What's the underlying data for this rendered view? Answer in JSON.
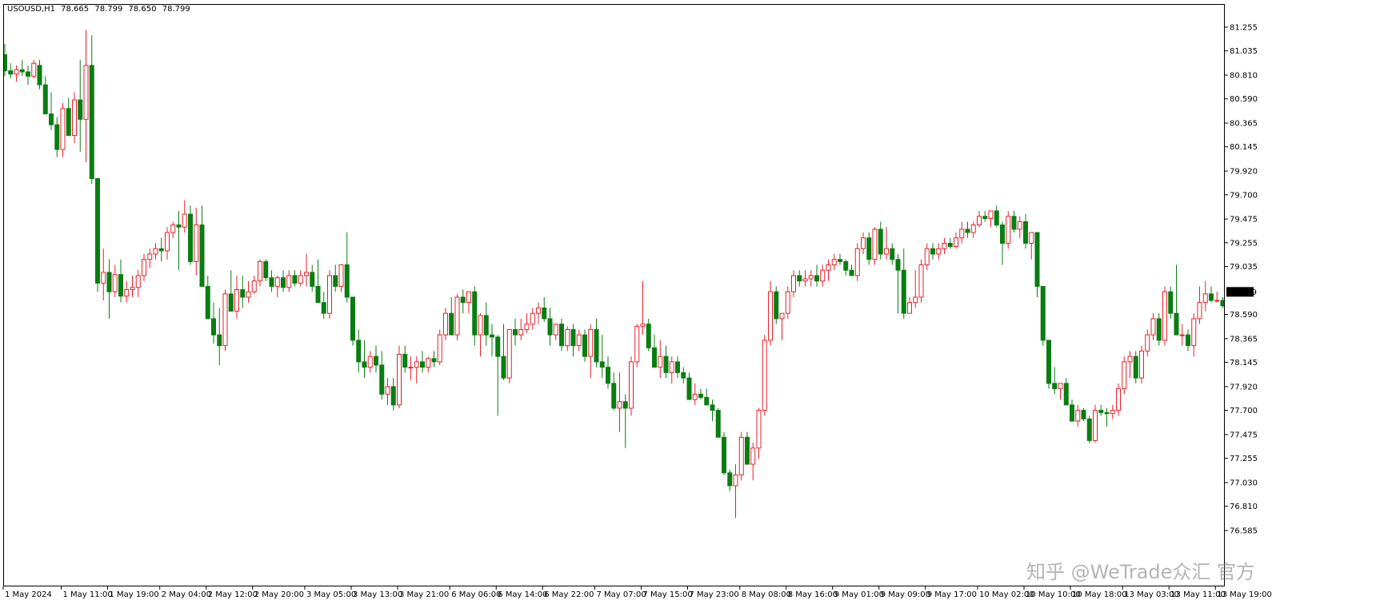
{
  "header": {
    "symbol": "USOUSD,H1",
    "open": "78.665",
    "high": "78.799",
    "low": "78.650",
    "close": "78.799"
  },
  "watermark": "知乎 @WeTrade众汇 官方",
  "colors": {
    "bull": "#e8202a",
    "bear": "#0a7d12",
    "axis": "#000000",
    "current_bg": "#000000",
    "current_fg": "#ffffff"
  },
  "chart_data": {
    "type": "candlestick",
    "title": "USOUSD,H1",
    "current_price": "78.799",
    "ylim": [
      76.6,
      81.5
    ],
    "y_ticks": [
      "81.255",
      "81.035",
      "80.810",
      "80.590",
      "80.365",
      "80.145",
      "79.920",
      "79.700",
      "79.475",
      "79.255",
      "79.035",
      "78.799",
      "78.590",
      "78.365",
      "78.145",
      "77.920",
      "77.700",
      "77.475",
      "77.255",
      "77.030",
      "76.810",
      "76.585"
    ],
    "y_tick_values": [
      81.255,
      81.035,
      80.81,
      80.59,
      80.365,
      80.145,
      79.92,
      79.7,
      79.475,
      79.255,
      79.035,
      78.799,
      78.59,
      78.365,
      78.145,
      77.92,
      77.7,
      77.475,
      77.255,
      77.03,
      76.81,
      76.585
    ],
    "x_ticks": [
      {
        "label": "1 May 2024",
        "index": 0
      },
      {
        "label": "1 May 11:00",
        "index": 10
      },
      {
        "label": "1 May 19:00",
        "index": 18
      },
      {
        "label": "2 May 04:00",
        "index": 27
      },
      {
        "label": "2 May 12:00",
        "index": 35
      },
      {
        "label": "2 May 20:00",
        "index": 43
      },
      {
        "label": "3 May 05:00",
        "index": 52
      },
      {
        "label": "3 May 13:00",
        "index": 60
      },
      {
        "label": "3 May 21:00",
        "index": 68
      },
      {
        "label": "6 May 06:00",
        "index": 77
      },
      {
        "label": "6 May 14:00",
        "index": 85
      },
      {
        "label": "6 May 22:00",
        "index": 93
      },
      {
        "label": "7 May 07:00",
        "index": 102
      },
      {
        "label": "7 May 15:00",
        "index": 110
      },
      {
        "label": "7 May 23:00",
        "index": 118
      },
      {
        "label": "8 May 08:00",
        "index": 127
      },
      {
        "label": "8 May 16:00",
        "index": 135
      },
      {
        "label": "9 May 01:00",
        "index": 143
      },
      {
        "label": "9 May 09:00",
        "index": 151
      },
      {
        "label": "9 May 17:00",
        "index": 159
      },
      {
        "label": "10 May 02:00",
        "index": 168
      },
      {
        "label": "10 May 10:00",
        "index": 176
      },
      {
        "label": "10 May 18:00",
        "index": 184
      },
      {
        "label": "13 May 03:00",
        "index": 193
      },
      {
        "label": "13 May 11:00",
        "index": 201
      },
      {
        "label": "13 May 19:00",
        "index": 209
      }
    ],
    "ohlc": [
      [
        81.0,
        81.1,
        80.8,
        80.85
      ],
      [
        80.85,
        80.92,
        80.78,
        80.82
      ],
      [
        80.82,
        80.9,
        80.75,
        80.86
      ],
      [
        80.86,
        80.95,
        80.8,
        80.84
      ],
      [
        80.84,
        80.9,
        80.72,
        80.8
      ],
      [
        80.8,
        80.95,
        80.78,
        80.92
      ],
      [
        80.9,
        80.95,
        80.68,
        80.72
      ],
      [
        80.72,
        80.8,
        80.45,
        80.45
      ],
      [
        80.45,
        80.65,
        80.3,
        80.35
      ],
      [
        80.35,
        80.42,
        80.05,
        80.12
      ],
      [
        80.12,
        80.55,
        80.05,
        80.5
      ],
      [
        80.5,
        80.6,
        80.25,
        80.25
      ],
      [
        80.25,
        80.65,
        80.18,
        80.58
      ],
      [
        80.58,
        80.95,
        80.1,
        80.4
      ],
      [
        80.4,
        81.23,
        80.0,
        80.9
      ],
      [
        80.9,
        81.18,
        79.8,
        79.85
      ],
      [
        79.85,
        79.85,
        78.8,
        78.88
      ],
      [
        78.88,
        79.2,
        78.72,
        78.98
      ],
      [
        78.98,
        79.1,
        78.55,
        78.8
      ],
      [
        78.8,
        79.05,
        78.75,
        78.96
      ],
      [
        78.96,
        79.1,
        78.7,
        78.76
      ],
      [
        78.76,
        78.9,
        78.7,
        78.82
      ],
      [
        78.82,
        78.95,
        78.75,
        78.84
      ],
      [
        78.84,
        79.0,
        78.75,
        78.95
      ],
      [
        78.95,
        79.15,
        78.9,
        79.1
      ],
      [
        79.1,
        79.2,
        79.02,
        79.15
      ],
      [
        79.15,
        79.25,
        79.1,
        79.2
      ],
      [
        79.2,
        79.3,
        79.08,
        79.18
      ],
      [
        79.18,
        79.4,
        79.1,
        79.35
      ],
      [
        79.35,
        79.45,
        79.3,
        79.42
      ],
      [
        79.42,
        79.55,
        79.0,
        79.4
      ],
      [
        79.4,
        79.65,
        79.35,
        79.52
      ],
      [
        79.52,
        79.6,
        79.05,
        79.08
      ],
      [
        79.08,
        79.58,
        78.95,
        79.42
      ],
      [
        79.42,
        79.6,
        78.85,
        78.85
      ],
      [
        78.85,
        78.95,
        78.55,
        78.55
      ],
      [
        78.55,
        78.7,
        78.32,
        78.4
      ],
      [
        78.4,
        78.65,
        78.12,
        78.3
      ],
      [
        78.3,
        78.82,
        78.25,
        78.78
      ],
      [
        78.78,
        79.0,
        78.62,
        78.62
      ],
      [
        78.62,
        78.95,
        78.55,
        78.82
      ],
      [
        78.82,
        78.95,
        78.65,
        78.75
      ],
      [
        78.75,
        78.9,
        78.7,
        78.8
      ],
      [
        78.8,
        78.95,
        78.78,
        78.9
      ],
      [
        78.9,
        79.1,
        78.85,
        79.08
      ],
      [
        79.08,
        79.1,
        78.9,
        78.93
      ],
      [
        78.93,
        79.0,
        78.8,
        78.85
      ],
      [
        78.85,
        78.95,
        78.75,
        78.93
      ],
      [
        78.93,
        79.0,
        78.8,
        78.84
      ],
      [
        78.84,
        79.0,
        78.8,
        78.95
      ],
      [
        78.95,
        79.0,
        78.85,
        78.88
      ],
      [
        78.88,
        79.0,
        78.85,
        78.95
      ],
      [
        78.95,
        79.15,
        78.85,
        78.98
      ],
      [
        78.98,
        79.05,
        78.8,
        78.85
      ],
      [
        78.85,
        79.1,
        78.7,
        78.7
      ],
      [
        78.7,
        78.8,
        78.55,
        78.6
      ],
      [
        78.6,
        79.0,
        78.55,
        78.95
      ],
      [
        78.95,
        79.05,
        78.8,
        78.85
      ],
      [
        78.85,
        79.05,
        78.8,
        79.05
      ],
      [
        79.05,
        79.35,
        78.7,
        78.75
      ],
      [
        78.75,
        78.75,
        78.3,
        78.35
      ],
      [
        78.35,
        78.45,
        78.05,
        78.15
      ],
      [
        78.15,
        78.35,
        78.0,
        78.1
      ],
      [
        78.1,
        78.25,
        78.05,
        78.2
      ],
      [
        78.2,
        78.3,
        78.05,
        78.12
      ],
      [
        78.12,
        78.25,
        77.8,
        77.85
      ],
      [
        77.85,
        78.0,
        77.75,
        77.92
      ],
      [
        77.92,
        78.0,
        77.7,
        77.75
      ],
      [
        77.75,
        78.3,
        77.72,
        78.22
      ],
      [
        78.22,
        78.3,
        78.05,
        78.1
      ],
      [
        78.1,
        78.2,
        77.98,
        78.1
      ],
      [
        78.1,
        78.2,
        77.95,
        78.15
      ],
      [
        78.15,
        78.25,
        78.05,
        78.1
      ],
      [
        78.1,
        78.2,
        78.05,
        78.18
      ],
      [
        78.18,
        78.25,
        78.1,
        78.15
      ],
      [
        78.15,
        78.45,
        78.12,
        78.4
      ],
      [
        78.4,
        78.65,
        78.35,
        78.6
      ],
      [
        78.6,
        78.75,
        78.4,
        78.4
      ],
      [
        78.4,
        78.78,
        78.35,
        78.75
      ],
      [
        78.75,
        78.82,
        78.6,
        78.7
      ],
      [
        78.7,
        78.8,
        78.6,
        78.8
      ],
      [
        78.8,
        78.85,
        78.3,
        78.4
      ],
      [
        78.4,
        78.6,
        78.2,
        78.58
      ],
      [
        78.58,
        78.7,
        78.3,
        78.4
      ],
      [
        78.4,
        78.5,
        78.2,
        78.38
      ],
      [
        78.38,
        78.4,
        77.65,
        78.2
      ],
      [
        78.2,
        78.5,
        77.98,
        78.0
      ],
      [
        78.0,
        78.45,
        77.95,
        78.45
      ],
      [
        78.45,
        78.55,
        78.3,
        78.4
      ],
      [
        78.4,
        78.55,
        78.35,
        78.45
      ],
      [
        78.45,
        78.6,
        78.42,
        78.5
      ],
      [
        78.5,
        78.65,
        78.45,
        78.6
      ],
      [
        78.6,
        78.7,
        78.5,
        78.65
      ],
      [
        78.65,
        78.75,
        78.52,
        78.55
      ],
      [
        78.55,
        78.65,
        78.3,
        78.4
      ],
      [
        78.4,
        78.5,
        78.35,
        78.5
      ],
      [
        78.5,
        78.55,
        78.25,
        78.3
      ],
      [
        78.3,
        78.48,
        78.25,
        78.45
      ],
      [
        78.45,
        78.5,
        78.2,
        78.3
      ],
      [
        78.3,
        78.45,
        78.25,
        78.4
      ],
      [
        78.4,
        78.45,
        78.15,
        78.2
      ],
      [
        78.2,
        78.5,
        78.0,
        78.45
      ],
      [
        78.45,
        78.55,
        78.1,
        78.15
      ],
      [
        78.15,
        78.4,
        78.0,
        78.1
      ],
      [
        78.1,
        78.2,
        77.9,
        77.95
      ],
      [
        77.95,
        78.05,
        77.7,
        77.72
      ],
      [
        77.72,
        78.05,
        77.5,
        77.78
      ],
      [
        77.78,
        77.85,
        77.35,
        77.72
      ],
      [
        77.72,
        78.2,
        77.65,
        78.15
      ],
      [
        78.15,
        78.5,
        78.1,
        78.48
      ],
      [
        78.48,
        78.9,
        78.4,
        78.5
      ],
      [
        78.5,
        78.55,
        78.25,
        78.28
      ],
      [
        78.28,
        78.4,
        78.1,
        78.1
      ],
      [
        78.1,
        78.35,
        78.0,
        78.2
      ],
      [
        78.2,
        78.3,
        78.0,
        78.05
      ],
      [
        78.05,
        78.2,
        77.95,
        78.15
      ],
      [
        78.15,
        78.2,
        78.0,
        78.05
      ],
      [
        78.05,
        78.1,
        77.95,
        78.0
      ],
      [
        78.0,
        78.05,
        77.8,
        77.8
      ],
      [
        77.8,
        77.95,
        77.75,
        77.85
      ],
      [
        77.85,
        77.9,
        77.8,
        77.82
      ],
      [
        77.82,
        77.9,
        77.75,
        77.75
      ],
      [
        77.75,
        77.8,
        77.6,
        77.7
      ],
      [
        77.7,
        77.72,
        77.45,
        77.45
      ],
      [
        77.45,
        77.5,
        77.1,
        77.12
      ],
      [
        77.12,
        77.15,
        76.95,
        77.0
      ],
      [
        77.0,
        77.2,
        76.7,
        77.1
      ],
      [
        77.1,
        77.5,
        77.05,
        77.45
      ],
      [
        77.45,
        77.5,
        77.2,
        77.2
      ],
      [
        77.2,
        77.4,
        77.05,
        77.35
      ],
      [
        77.35,
        77.72,
        77.25,
        77.7
      ],
      [
        77.7,
        78.4,
        77.65,
        78.35
      ],
      [
        78.35,
        78.9,
        78.3,
        78.8
      ],
      [
        78.8,
        78.85,
        78.5,
        78.55
      ],
      [
        78.55,
        78.6,
        78.35,
        78.6
      ],
      [
        78.6,
        78.85,
        78.55,
        78.8
      ],
      [
        78.8,
        79.0,
        78.75,
        78.95
      ],
      [
        78.95,
        79.0,
        78.85,
        78.9
      ],
      [
        78.9,
        79.0,
        78.85,
        78.92
      ],
      [
        78.92,
        79.0,
        78.85,
        78.95
      ],
      [
        78.95,
        79.05,
        78.85,
        78.9
      ],
      [
        78.9,
        79.05,
        78.85,
        79.0
      ],
      [
        79.0,
        79.1,
        78.9,
        79.05
      ],
      [
        79.05,
        79.15,
        79.0,
        79.1
      ],
      [
        79.1,
        79.15,
        79.05,
        79.08
      ],
      [
        79.08,
        79.1,
        78.95,
        79.0
      ],
      [
        79.0,
        79.05,
        78.95,
        78.95
      ],
      [
        78.95,
        79.25,
        78.9,
        79.2
      ],
      [
        79.2,
        79.35,
        79.15,
        79.3
      ],
      [
        79.3,
        79.35,
        79.05,
        79.1
      ],
      [
        79.1,
        79.4,
        79.05,
        79.38
      ],
      [
        79.38,
        79.45,
        79.1,
        79.15
      ],
      [
        79.15,
        79.4,
        79.1,
        79.2
      ],
      [
        79.2,
        79.25,
        79.05,
        79.1
      ],
      [
        79.1,
        79.15,
        78.6,
        79.0
      ],
      [
        79.0,
        79.2,
        78.55,
        78.6
      ],
      [
        78.6,
        78.75,
        78.6,
        78.7
      ],
      [
        78.7,
        79.0,
        78.65,
        78.75
      ],
      [
        78.75,
        79.1,
        78.7,
        79.05
      ],
      [
        79.05,
        79.25,
        79.0,
        79.2
      ],
      [
        79.2,
        79.25,
        79.1,
        79.15
      ],
      [
        79.15,
        79.25,
        79.1,
        79.2
      ],
      [
        79.2,
        79.3,
        79.15,
        79.25
      ],
      [
        79.25,
        79.3,
        79.2,
        79.22
      ],
      [
        79.22,
        79.35,
        79.2,
        79.3
      ],
      [
        79.3,
        79.45,
        79.25,
        79.38
      ],
      [
        79.38,
        79.45,
        79.3,
        79.35
      ],
      [
        79.35,
        79.45,
        79.3,
        79.42
      ],
      [
        79.42,
        79.55,
        79.4,
        79.5
      ],
      [
        79.5,
        79.55,
        79.45,
        79.48
      ],
      [
        79.48,
        79.55,
        79.4,
        79.55
      ],
      [
        79.55,
        79.6,
        79.4,
        79.42
      ],
      [
        79.42,
        79.45,
        79.05,
        79.25
      ],
      [
        79.25,
        79.55,
        79.2,
        79.5
      ],
      [
        79.5,
        79.55,
        79.35,
        79.38
      ],
      [
        79.38,
        79.5,
        79.3,
        79.45
      ],
      [
        79.45,
        79.52,
        79.2,
        79.25
      ],
      [
        79.25,
        79.35,
        79.1,
        79.35
      ],
      [
        79.35,
        79.35,
        78.75,
        78.85
      ],
      [
        78.85,
        78.85,
        78.3,
        78.35
      ],
      [
        78.35,
        78.35,
        77.9,
        77.95
      ],
      [
        77.95,
        78.1,
        77.85,
        77.9
      ],
      [
        77.9,
        77.95,
        77.8,
        77.95
      ],
      [
        77.95,
        78.0,
        77.75,
        77.75
      ],
      [
        77.75,
        77.8,
        77.6,
        77.6
      ],
      [
        77.6,
        77.75,
        77.55,
        77.7
      ],
      [
        77.7,
        77.72,
        77.6,
        77.62
      ],
      [
        77.62,
        77.65,
        77.4,
        77.42
      ],
      [
        77.42,
        77.75,
        77.4,
        77.7
      ],
      [
        77.7,
        77.75,
        77.65,
        77.68
      ],
      [
        77.68,
        77.72,
        77.55,
        77.67
      ],
      [
        77.67,
        77.75,
        77.62,
        77.7
      ],
      [
        77.7,
        77.95,
        77.65,
        77.9
      ],
      [
        77.9,
        78.2,
        77.85,
        78.15
      ],
      [
        78.15,
        78.25,
        78.0,
        78.2
      ],
      [
        78.2,
        78.25,
        77.95,
        78.0
      ],
      [
        78.0,
        78.3,
        77.95,
        78.25
      ],
      [
        78.25,
        78.45,
        78.2,
        78.4
      ],
      [
        78.4,
        78.6,
        78.35,
        78.55
      ],
      [
        78.55,
        78.6,
        78.3,
        78.35
      ],
      [
        78.35,
        78.85,
        78.3,
        78.8
      ],
      [
        78.8,
        78.85,
        78.55,
        78.6
      ],
      [
        78.6,
        79.05,
        78.55,
        78.4
      ],
      [
        78.4,
        78.5,
        78.3,
        78.4
      ],
      [
        78.4,
        78.45,
        78.25,
        78.3
      ],
      [
        78.3,
        78.6,
        78.2,
        78.55
      ],
      [
        78.55,
        78.85,
        78.5,
        78.7
      ],
      [
        78.7,
        78.9,
        78.62,
        78.78
      ],
      [
        78.78,
        78.85,
        78.7,
        78.72
      ],
      [
        78.72,
        78.8,
        78.7,
        78.72
      ],
      [
        78.72,
        78.75,
        78.65,
        78.67
      ],
      [
        78.665,
        78.799,
        78.65,
        78.799
      ]
    ]
  }
}
